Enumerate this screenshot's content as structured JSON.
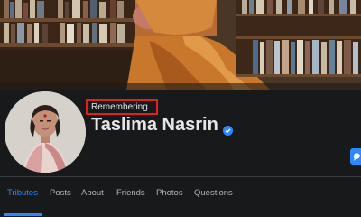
{
  "profile": {
    "badge_text": "Remembering",
    "name": "Taslima Nasrin",
    "verified_icon": "verified-check-icon"
  },
  "tabs": [
    {
      "label": "Tributes",
      "active": true
    },
    {
      "label": "Posts",
      "active": false
    },
    {
      "label": "About",
      "active": false
    },
    {
      "label": "Friends",
      "active": false
    },
    {
      "label": "Photos",
      "active": false
    },
    {
      "label": "Questions",
      "active": false
    }
  ],
  "colors": {
    "accent": "#2d88ff",
    "highlight_box": "#e0211d",
    "background": "#18191a"
  }
}
